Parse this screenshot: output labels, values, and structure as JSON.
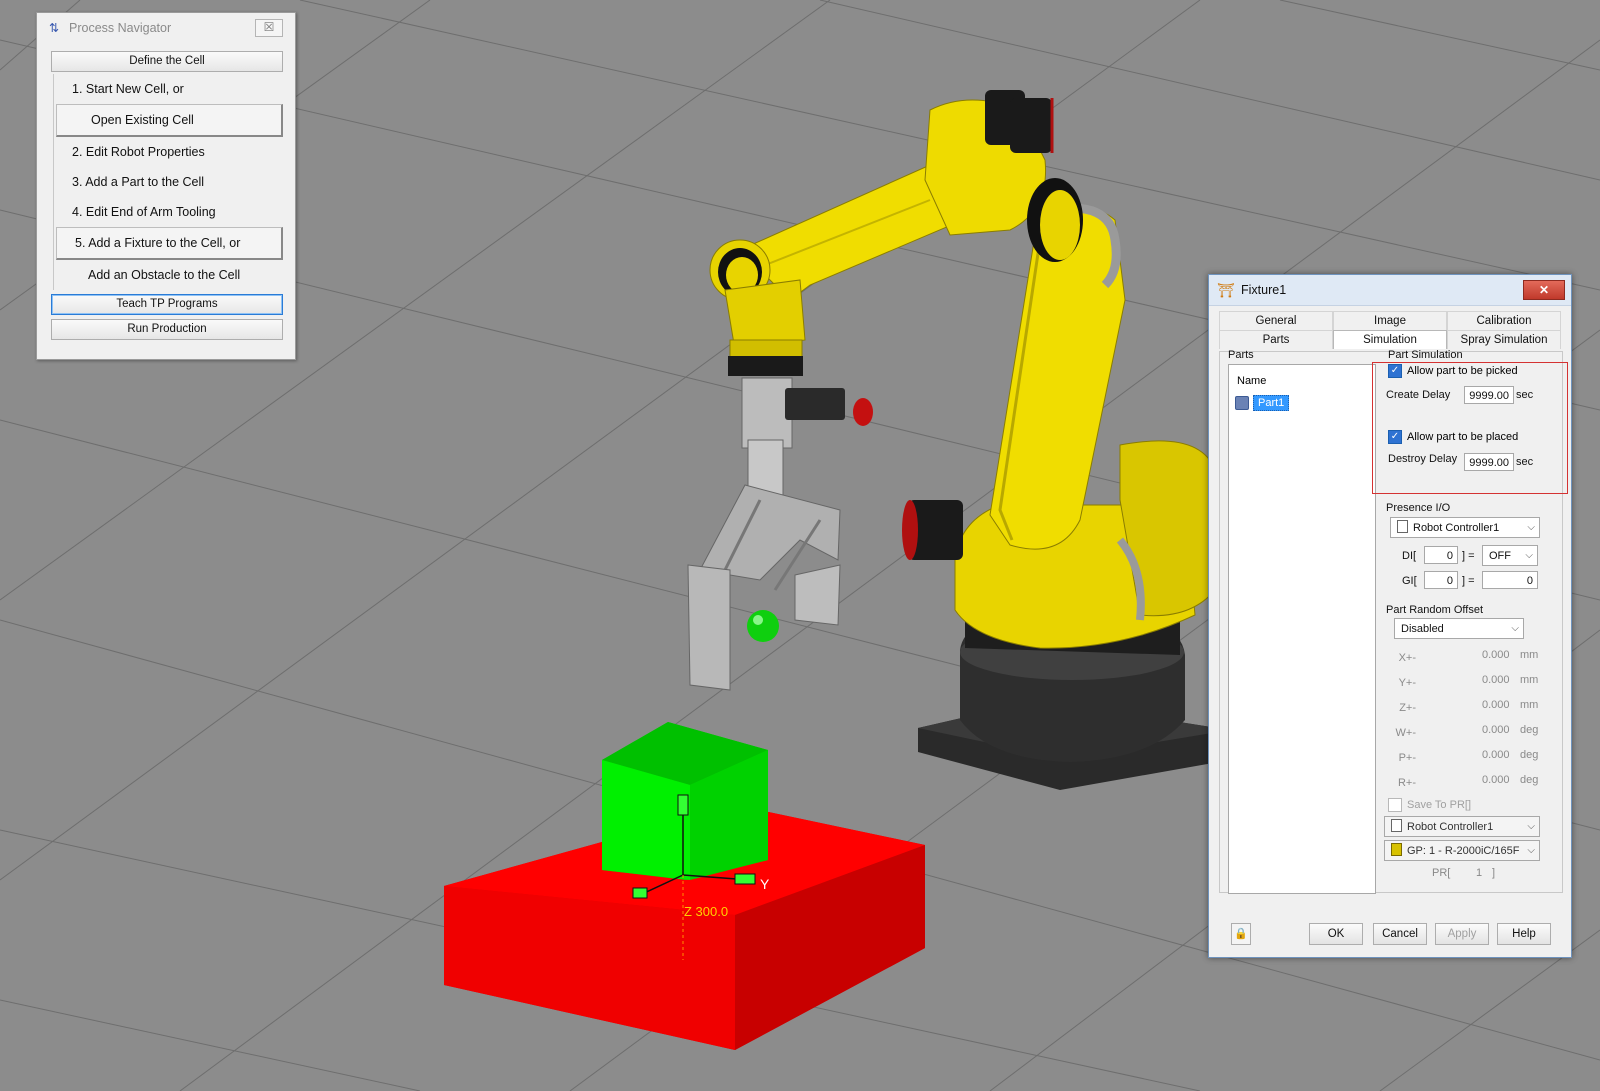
{
  "viewport": {
    "axis_label_y": "Y",
    "axis_readout": "Z 300.0"
  },
  "process_navigator": {
    "title": "Process Navigator",
    "close_glyph": "☒",
    "define_cell_label": "Define the Cell",
    "steps": [
      "1.  Start New Cell, or",
      "Open Existing Cell",
      "2.  Edit Robot Properties",
      "3.  Add a Part to the Cell",
      "4.  Edit End of Arm Tooling",
      "5.  Add a Fixture to the Cell, or",
      "Add an Obstacle to the Cell"
    ],
    "teach_label": "Teach TP Programs",
    "run_label": "Run Production"
  },
  "fixture_dialog": {
    "title": "Fixture1",
    "close_glyph": "✕",
    "tabs_row1": [
      "General",
      "Image",
      "Calibration"
    ],
    "tabs_row2": [
      "Parts",
      "Simulation",
      "Spray Simulation"
    ],
    "active_tab": "Simulation",
    "parts": {
      "group_label": "Parts",
      "column_name": "Name",
      "items": [
        "Part1"
      ]
    },
    "part_simulation": {
      "group_label": "Part Simulation",
      "allow_picked_label": "Allow part to be picked",
      "allow_picked": true,
      "create_delay_label": "Create Delay",
      "create_delay_value": "9999.00",
      "create_delay_unit": "sec",
      "allow_placed_label": "Allow part to be placed",
      "allow_placed": true,
      "destroy_delay_label": "Destroy Delay",
      "destroy_delay_value": "9999.00",
      "destroy_delay_unit": "sec"
    },
    "presence_io": {
      "group_label": "Presence I/O",
      "controller": "Robot Controller1",
      "di_label": "DI[",
      "di_index": "0",
      "di_eq": "] =",
      "di_value": "OFF",
      "gi_label": "GI[",
      "gi_index": "0",
      "gi_eq": "] =",
      "gi_value": "0"
    },
    "random_offset": {
      "group_label": "Part Random Offset",
      "mode": "Disabled",
      "rows": [
        {
          "label": "X+-",
          "value": "0.000",
          "unit": "mm"
        },
        {
          "label": "Y+-",
          "value": "0.000",
          "unit": "mm"
        },
        {
          "label": "Z+-",
          "value": "0.000",
          "unit": "mm"
        },
        {
          "label": "W+-",
          "value": "0.000",
          "unit": "deg"
        },
        {
          "label": "P+-",
          "value": "0.000",
          "unit": "deg"
        },
        {
          "label": "R+-",
          "value": "0.000",
          "unit": "deg"
        }
      ],
      "save_to_pr_label": "Save To PR[]",
      "controller": "Robot Controller1",
      "group": "GP: 1 - R-2000iC/165F",
      "pr_label": "PR[",
      "pr_index": "1",
      "pr_close": "]"
    },
    "buttons": {
      "ok": "OK",
      "cancel": "Cancel",
      "apply": "Apply",
      "help": "Help"
    }
  },
  "colors": {
    "floor": "#8c8c8c",
    "robot_yellow": "#f0dd00",
    "fixture_red": "#ff0000",
    "part_green": "#00e600",
    "highlight_frame": "#d43232"
  }
}
